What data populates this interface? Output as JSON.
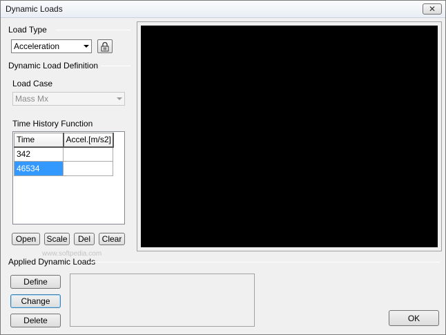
{
  "window": {
    "title": "Dynamic Loads",
    "close_symbol": "✕"
  },
  "load_type": {
    "label": "Load Type",
    "selected": "Acceleration"
  },
  "definition": {
    "label": "Dynamic Load Definition",
    "load_case_label": "Load Case",
    "load_case_selected": "Mass Mx"
  },
  "time_history": {
    "label": "Time History Function",
    "columns": [
      "Time",
      "Accel.[m/s2]"
    ],
    "rows": [
      [
        "342",
        ""
      ],
      [
        "46534",
        ""
      ]
    ]
  },
  "table_buttons": {
    "open": "Open",
    "scale": "Scale",
    "del": "Del",
    "clear": "Clear"
  },
  "applied": {
    "label": "Applied Dynamic Loads",
    "define": "Define",
    "change": "Change",
    "delete": "Delete"
  },
  "ok_label": "OK",
  "watermark": "www.softpedia.com",
  "icons": {
    "lock": "lock-icon",
    "close": "close-icon",
    "dropdown": "chevron-down-icon"
  }
}
